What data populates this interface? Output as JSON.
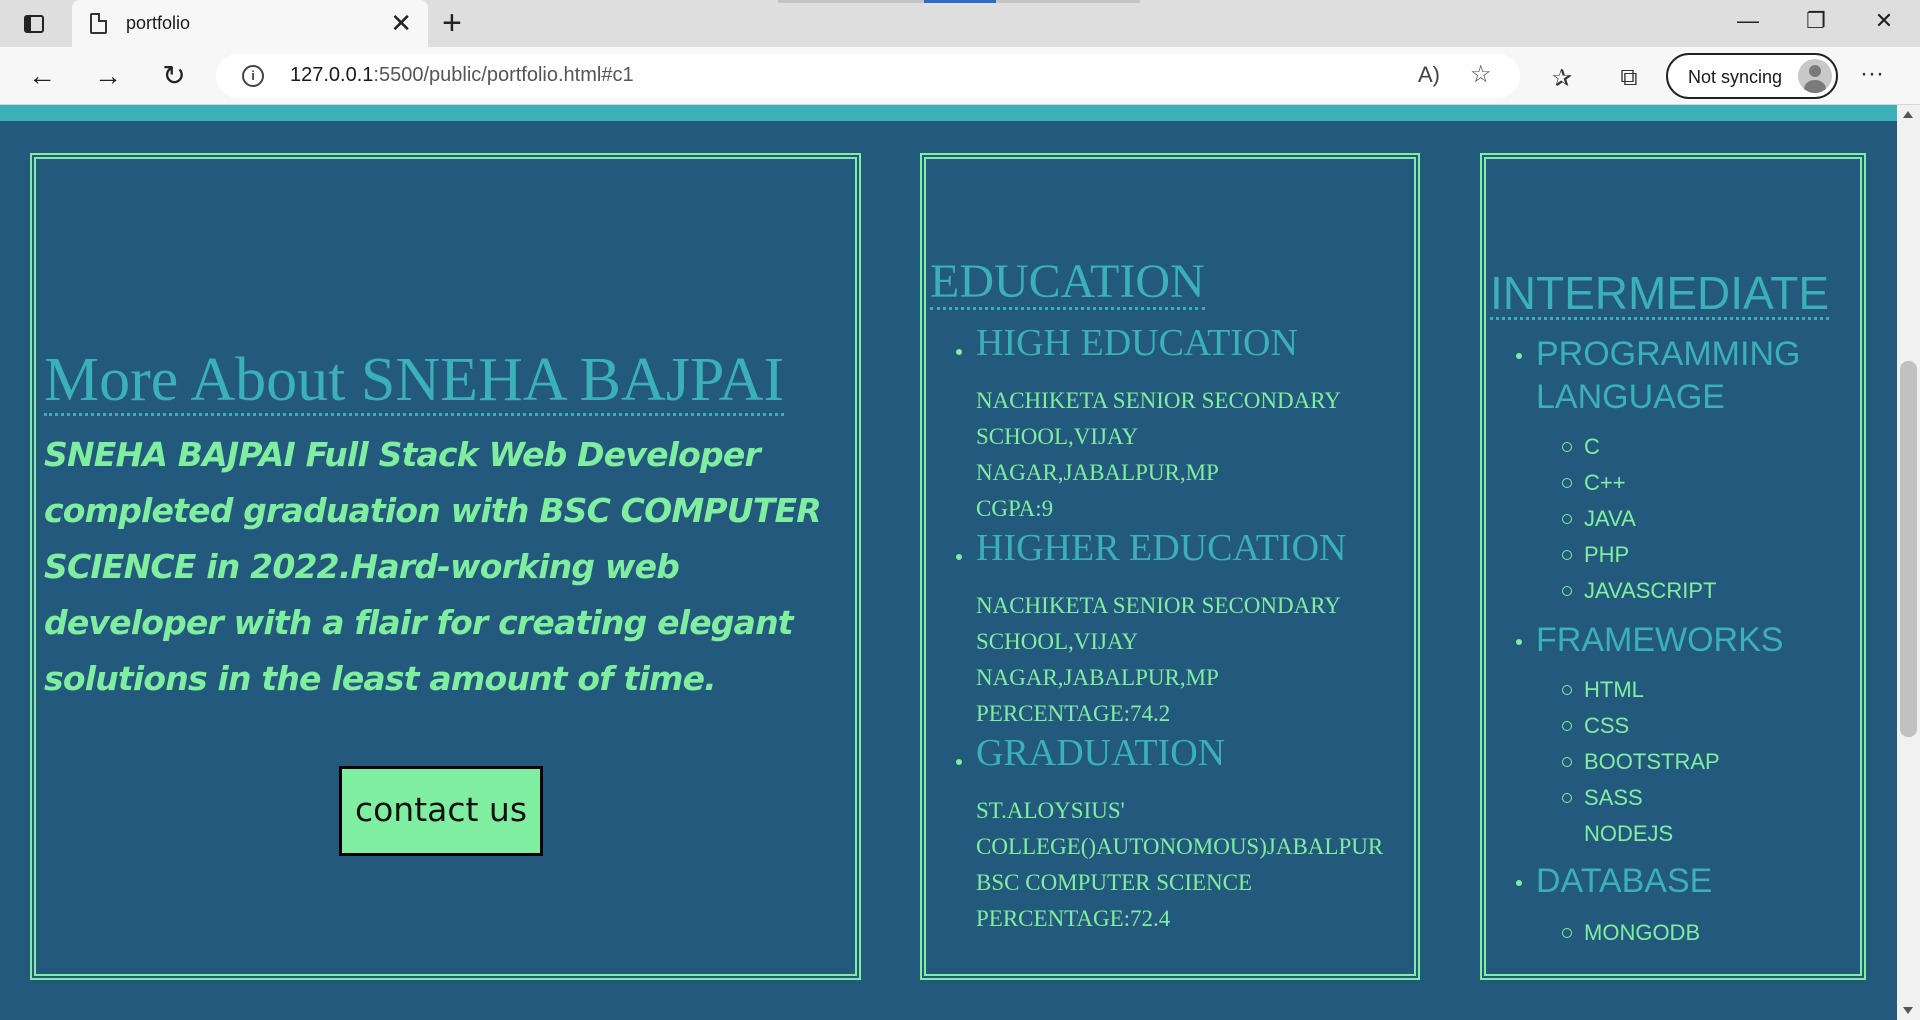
{
  "browser": {
    "tab_title": "portfolio",
    "url_host": "127.0.0.1",
    "url_rest": ":5500/public/portfolio.html#c1",
    "sync_label": "Not syncing",
    "read_icon": "Aᵀ⁾"
  },
  "about": {
    "title": "More About SNEHA BAJPAI",
    "text": "SNEHA BAJPAI Full Stack Web Developer completed graduation with BSC COMPUTER SCIENCE in 2022.Hard-working web developer with a flair for creating elegant solutions in the least amount of time.",
    "contact_label": "contact us"
  },
  "education": {
    "title": "EDUCATION",
    "items": [
      {
        "head": "HIGH EDUCATION",
        "detail": "NACHIKETA SENIOR SECONDARY\nSCHOOL,VIJAY\nNAGAR,JABALPUR,MP\nCGPA:9"
      },
      {
        "head": "HIGHER EDUCATION",
        "detail": "NACHIKETA SENIOR SECONDARY\nSCHOOL,VIJAY\nNAGAR,JABALPUR,MP\nPERCENTAGE:74.2"
      },
      {
        "head": "GRADUATION",
        "detail": "ST.ALOYSIUS'\nCOLLEGE()AUTONOMOUS)JABALPUR\nBSC COMPUTER SCIENCE\nPERCENTAGE:72.4"
      }
    ]
  },
  "skills": {
    "title": "INTERMEDIATE",
    "categories": [
      {
        "name_line1": "PROGRAMMING",
        "name_line2": "LANGUAGE",
        "items": [
          "C",
          "C++",
          "JAVA",
          "PHP",
          "JAVASCRIPT"
        ]
      },
      {
        "name_line1": "FRAMEWORKS",
        "items": [
          "HTML",
          "CSS",
          "BOOTSTRAP",
          "SASS",
          "NODEJS"
        ]
      },
      {
        "name_line1": "DATABASE",
        "items": [
          "MONGODB"
        ]
      }
    ]
  },
  "colors": {
    "page_bg": "#23597c",
    "accent_green": "#80eea0",
    "accent_teal": "#3bb0b8"
  }
}
